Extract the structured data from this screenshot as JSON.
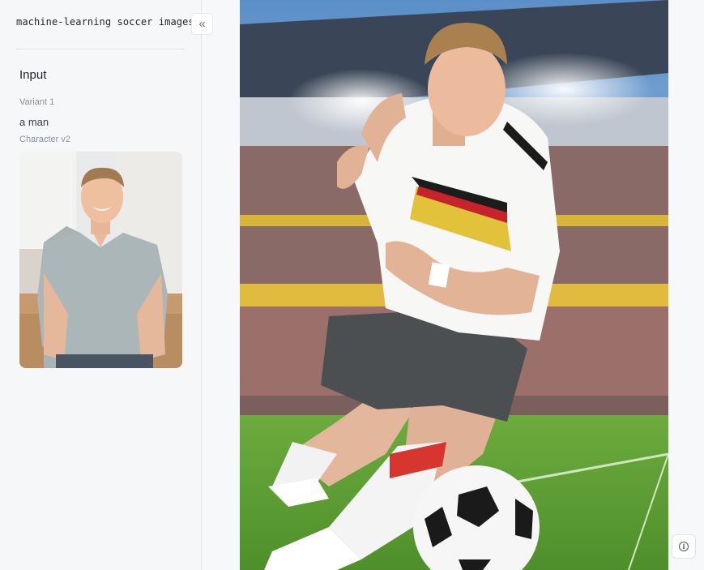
{
  "sidebar": {
    "title": "machine-learning soccer images",
    "collapse_icon": "«",
    "input_heading": "Input",
    "variant_label": "Variant 1",
    "prompt_value": "a man",
    "character_label": "Character v2"
  },
  "info_icon": "i"
}
